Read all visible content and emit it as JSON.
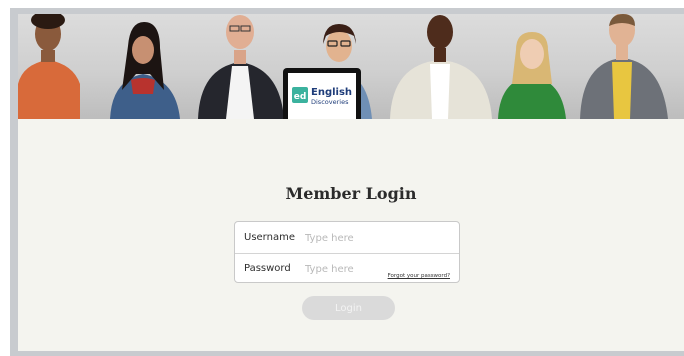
{
  "banner": {
    "logo_mark": "ed",
    "logo_line1": "English",
    "logo_line2": "Discoveries",
    "people_icons": [
      "person-1",
      "person-2",
      "person-3",
      "person-4",
      "person-5",
      "person-6",
      "person-7"
    ]
  },
  "login": {
    "title": "Member Login",
    "username_label": "Username",
    "username_placeholder": "Type here",
    "username_value": "",
    "password_label": "Password",
    "password_placeholder": "Type here",
    "password_value": "",
    "forgot_link": "Forgot your password?",
    "button_label": "Login"
  },
  "colors": {
    "page_bg": "#f4f4ef",
    "button_disabled": "#dadada",
    "logo_green": "#3bb29e",
    "logo_navy": "#1f3d7a"
  }
}
